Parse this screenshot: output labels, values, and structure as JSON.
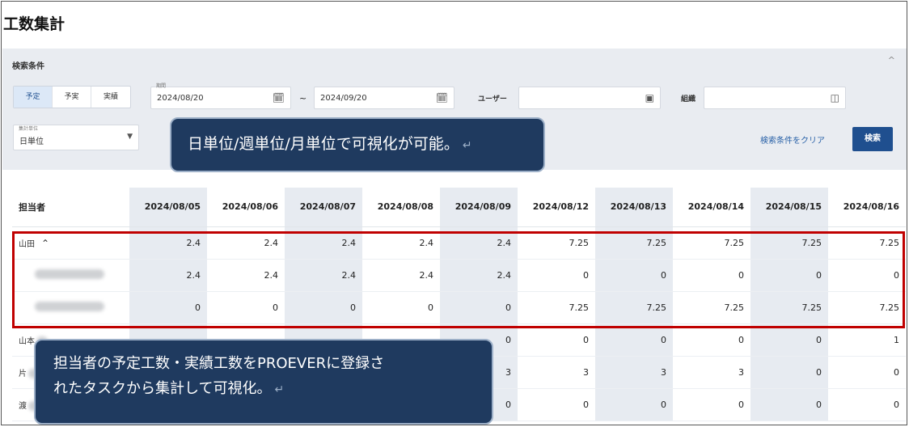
{
  "page": {
    "title": "工数集計"
  },
  "filter": {
    "title": "検索条件",
    "collapse_icon": "^",
    "mode_tabs": [
      "予定",
      "予実",
      "実績"
    ],
    "period_label": "期間",
    "date_from": "2024/08/20",
    "date_sep": "~",
    "date_to": "2024/09/20",
    "user_label": "ユーザー",
    "user_value": "",
    "org_label": "組織",
    "org_value": "",
    "unit_label": "集計単位",
    "unit_value": "日単位",
    "clear_label": "検索条件をクリア",
    "search_label": "検索"
  },
  "table": {
    "header_name": "担当者",
    "dates": [
      "2024/08/05",
      "2024/08/06",
      "2024/08/07",
      "2024/08/08",
      "2024/08/09",
      "2024/08/12",
      "2024/08/13",
      "2024/08/14",
      "2024/08/15",
      "2024/08/16"
    ],
    "rows": [
      {
        "name": "山田",
        "expanded": true,
        "values": [
          "2.4",
          "2.4",
          "2.4",
          "2.4",
          "2.4",
          "7.25",
          "7.25",
          "7.25",
          "7.25",
          "7.25"
        ]
      },
      {
        "name": "",
        "values": [
          "2.4",
          "2.4",
          "2.4",
          "2.4",
          "2.4",
          "0",
          "0",
          "0",
          "0",
          "0"
        ]
      },
      {
        "name": "",
        "values": [
          "0",
          "0",
          "0",
          "0",
          "0",
          "7.25",
          "7.25",
          "7.25",
          "7.25",
          "7.25"
        ]
      },
      {
        "name": "山本",
        "values": [
          "",
          "",
          "",
          "",
          "0",
          "0",
          "0",
          "0",
          "0",
          "1"
        ]
      },
      {
        "name": "片",
        "values": [
          "",
          "",
          "",
          "",
          "3",
          "3",
          "3",
          "3",
          "0",
          "0"
        ]
      },
      {
        "name": "渡",
        "values": [
          "",
          "",
          "",
          "",
          "0",
          "0",
          "0",
          "0",
          "0",
          "0"
        ]
      }
    ]
  },
  "callouts": {
    "top": "日単位/週単位/月単位で可視化が可能。",
    "bottom_line1": "担当者の予定工数・実績工数をPROEVERに登録さ",
    "bottom_line2": "れたタスクから集計して可視化。",
    "return_mark": "↵"
  },
  "colors": {
    "accent": "#1f4f8f",
    "highlight": "#c00000",
    "callout": "#1f3a5f",
    "panel": "#e9ecf1"
  }
}
